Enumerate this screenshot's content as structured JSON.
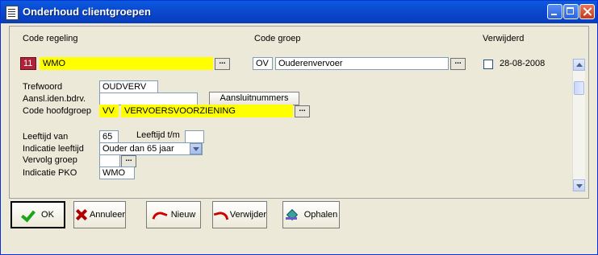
{
  "window": {
    "title": "Onderhoud clientgroepen"
  },
  "headers": {
    "code_regeling": "Code regeling",
    "code_groep": "Code groep",
    "verwijderd": "Verwijderd"
  },
  "row": {
    "regeling_code": "11",
    "regeling_name": "WMO",
    "groep_code": "OV",
    "groep_name": "Ouderenvervoer",
    "verwijderd_date": "28-08-2008",
    "lookup_glyph": "..."
  },
  "detail": {
    "trefwoord_label": "Trefwoord",
    "trefwoord_value": "OUDVERV",
    "aansl_label": "Aansl.iden.bdrv.",
    "aansl_value": "",
    "aansluitnummers_button": "Aansluitnummers",
    "hoofdgroep_label": "Code hoofdgroep",
    "hoofdgroep_code": "VV",
    "hoofdgroep_name": "VERVOERSVOORZIENING",
    "leeftijd_van_label": "Leeftijd van",
    "leeftijd_van_value": "65",
    "leeftijd_tm_label": "Leeftijd t/m",
    "leeftijd_tm_value": "",
    "indicatie_leeftijd_label": "Indicatie leeftijd",
    "indicatie_leeftijd_value": "Ouder dan 65 jaar",
    "vervolg_groep_label": "Vervolg groep",
    "vervolg_groep_value": "",
    "indicatie_pko_label": "Indicatie PKO",
    "indicatie_pko_value": "WMO"
  },
  "actions": {
    "ok": "OK",
    "annuleer": "Annuleer",
    "nieuw": "Nieuw",
    "verwijder": "Verwijder",
    "ophalen": "Ophalen"
  }
}
